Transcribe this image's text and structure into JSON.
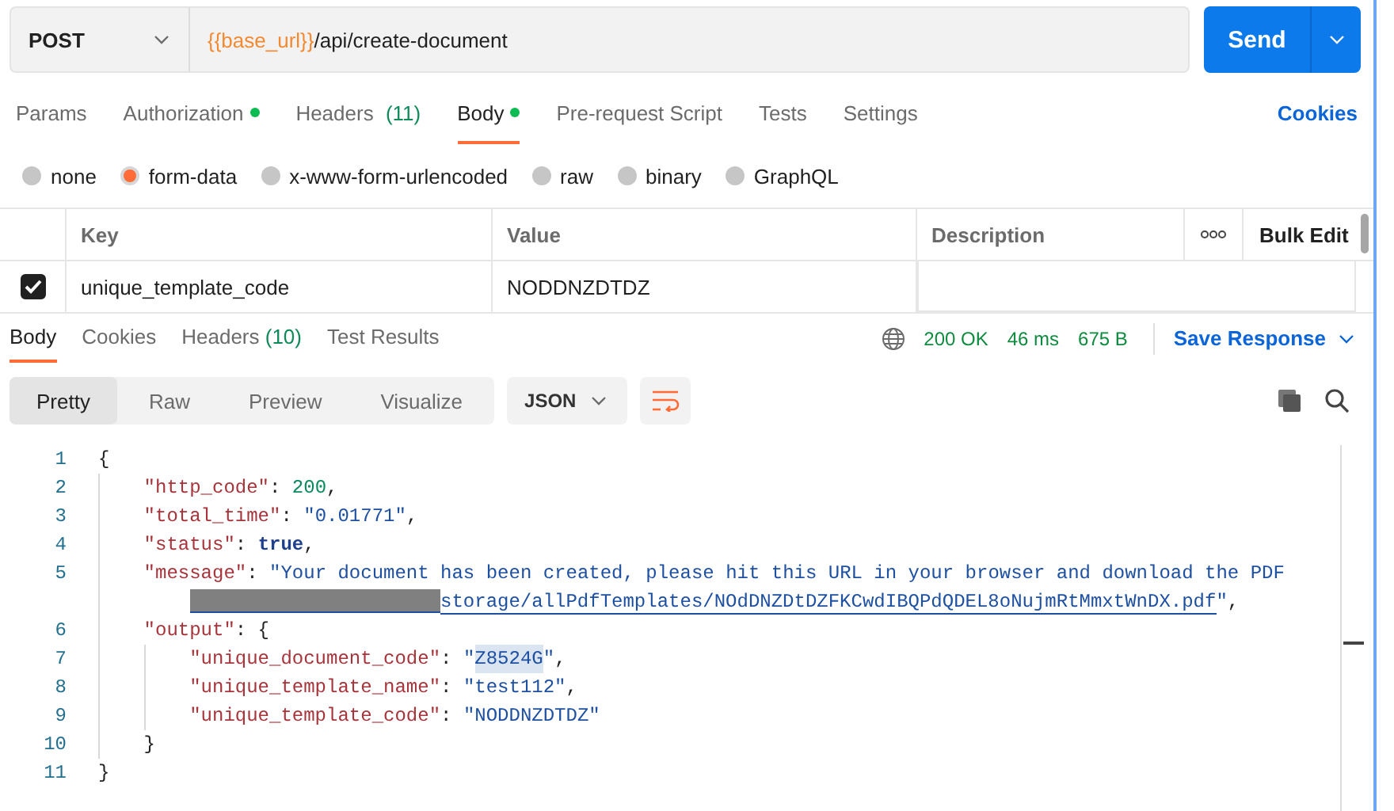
{
  "request": {
    "method": "POST",
    "url": [
      {
        "kind": "variable",
        "text": "{{base_url}}"
      },
      {
        "kind": "path",
        "text": "/api/create-document"
      }
    ],
    "send": "Send"
  },
  "request_tabs": [
    {
      "label": "Params",
      "selected": false,
      "dot": false
    },
    {
      "label": "Authorization",
      "selected": false,
      "dot": true
    },
    {
      "label": "Headers",
      "count": "(11)",
      "selected": false,
      "dot": false
    },
    {
      "label": "Body",
      "selected": true,
      "dot": true
    },
    {
      "label": "Pre-request Script",
      "selected": false,
      "dot": false
    },
    {
      "label": "Tests",
      "selected": false,
      "dot": false
    },
    {
      "label": "Settings",
      "selected": false,
      "dot": false
    }
  ],
  "cookies": "Cookies",
  "body_types": [
    {
      "label": "none",
      "selected": false
    },
    {
      "label": "form-data",
      "selected": true
    },
    {
      "label": "x-www-form-urlencoded",
      "selected": false
    },
    {
      "label": "raw",
      "selected": false
    },
    {
      "label": "binary",
      "selected": false
    },
    {
      "label": "GraphQL",
      "selected": false
    }
  ],
  "params_table": {
    "columns": [
      "Key",
      "Value",
      "Description"
    ],
    "bulk_edit": "Bulk Edit",
    "rows": [
      {
        "checked": true,
        "key": "unique_template_code",
        "value": "NODDNZDTDZ"
      }
    ]
  },
  "response": {
    "tabs": [
      {
        "label": "Body",
        "selected": true
      },
      {
        "label": "Cookies",
        "selected": false
      },
      {
        "label": "Headers",
        "count": "(10)",
        "selected": false
      },
      {
        "label": "Test Results",
        "selected": false
      }
    ],
    "status": "200 OK",
    "time": "46 ms",
    "size": "675 B",
    "save": "Save Response",
    "view_modes": [
      {
        "label": "Pretty",
        "selected": true
      },
      {
        "label": "Raw",
        "selected": false
      },
      {
        "label": "Preview",
        "selected": false
      },
      {
        "label": "Visualize",
        "selected": false
      }
    ],
    "format": "JSON",
    "lines": [
      {
        "number": "1",
        "tokens": [
          {
            "kind": "punct",
            "text": "{"
          }
        ],
        "children": [
          {
            "number": "2",
            "tokens": [
              {
                "kind": "key",
                "text": "\"http_code\""
              },
              {
                "kind": "punct",
                "text": ": "
              },
              {
                "kind": "number",
                "text": "200"
              },
              {
                "kind": "punct",
                "text": ","
              }
            ]
          },
          {
            "number": "3",
            "tokens": [
              {
                "kind": "key",
                "text": "\"total_time\""
              },
              {
                "kind": "punct",
                "text": ": "
              },
              {
                "kind": "string",
                "text": "\"0.01771\""
              },
              {
                "kind": "punct",
                "text": ","
              }
            ]
          },
          {
            "number": "4",
            "tokens": [
              {
                "kind": "key",
                "text": "\"status\""
              },
              {
                "kind": "punct",
                "text": ": "
              },
              {
                "kind": "bool",
                "text": "true"
              },
              {
                "kind": "punct",
                "text": ","
              }
            ]
          },
          {
            "number": "5",
            "tokens": [
              {
                "kind": "key",
                "text": "\"message\""
              },
              {
                "kind": "punct",
                "text": ": "
              },
              {
                "kind": "string",
                "text": "\"Your document has been created, please hit this URL in your browser and download the PDF"
              }
            ],
            "wrap": [
              {
                "kind": "redacted"
              },
              {
                "kind": "link",
                "text": "storage/allPdfTemplates/NOdDNZDtDZFKCwdIBQPdQDEL8oNujmRtMmxtWnDX.pdf"
              },
              {
                "kind": "string",
                "text": "\""
              },
              {
                "kind": "punct",
                "text": ","
              }
            ]
          },
          {
            "number": "6",
            "tokens": [
              {
                "kind": "key",
                "text": "\"output\""
              },
              {
                "kind": "punct",
                "text": ": {"
              }
            ],
            "children": [
              {
                "number": "7",
                "tokens": [
                  {
                    "kind": "key",
                    "text": "\"unique_document_code\""
                  },
                  {
                    "kind": "punct",
                    "text": ": "
                  },
                  {
                    "kind": "string",
                    "text": "\""
                  },
                  {
                    "kind": "string",
                    "text": "Z8524G",
                    "highlighted": true
                  },
                  {
                    "kind": "string",
                    "text": "\""
                  },
                  {
                    "kind": "punct",
                    "text": ","
                  }
                ]
              },
              {
                "number": "8",
                "tokens": [
                  {
                    "kind": "key",
                    "text": "\"unique_template_name\""
                  },
                  {
                    "kind": "punct",
                    "text": ": "
                  },
                  {
                    "kind": "string",
                    "text": "\"test112\""
                  },
                  {
                    "kind": "punct",
                    "text": ","
                  }
                ]
              },
              {
                "number": "9",
                "tokens": [
                  {
                    "kind": "key",
                    "text": "\"unique_template_code\""
                  },
                  {
                    "kind": "punct",
                    "text": ": "
                  },
                  {
                    "kind": "string",
                    "text": "\"NODDNZDTDZ\""
                  }
                ]
              }
            ]
          },
          {
            "number": "10",
            "tokens": [
              {
                "kind": "punct",
                "text": "}"
              }
            ]
          }
        ]
      },
      {
        "number": "11",
        "tokens": [
          {
            "kind": "punct",
            "text": "}"
          }
        ]
      }
    ]
  }
}
